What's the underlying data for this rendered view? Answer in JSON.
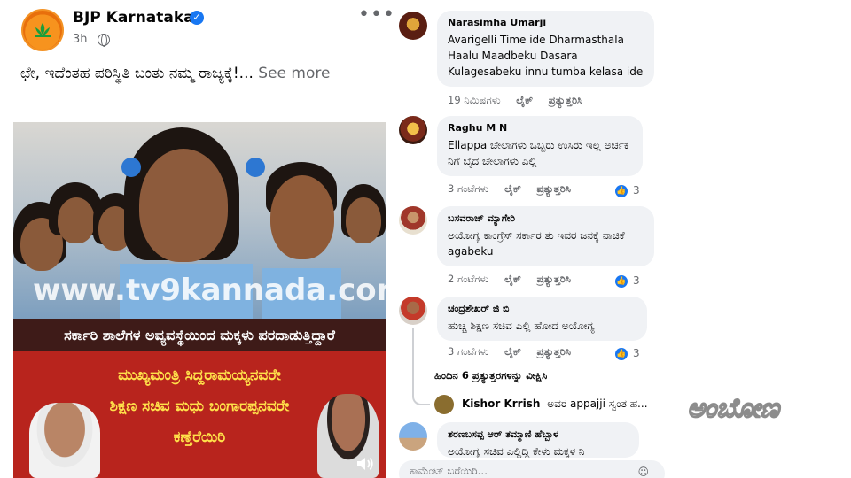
{
  "post": {
    "page_name": "BJP Karnataka",
    "time": "3h",
    "caption": "ಛೇ, ಇದೆಂತಹ ಪರಿಸ್ಥಿತಿ ಬಂತು ನಮ್ಮ ರಾಜ್ಯಕ್ಕೆ!...",
    "see_more": "See more",
    "media": {
      "watermark": "www.tv9kannada.com",
      "banner_line1": "ಸರ್ಕಾರಿ ಶಾಲೆಗಳ ಅವ್ಯವಸ್ಥೆಯಿಂದ ಮಕ್ಕಳು ಪರದಾಡುತ್ತಿದ್ದಾರೆ",
      "banner_line2": "ಮುಖ್ಯಮಂತ್ರಿ ಸಿದ್ದರಾಮಯ್ಯನವರೇ",
      "banner_line3": "ಶಿಕ್ಷಣ ಸಚಿವ ಮಧು ಬಂಗಾರಪ್ಪನವರೇ",
      "banner_line4": "ಕಣ್ತೆರೆಯಿರಿ"
    }
  },
  "comments": [
    {
      "name": "Narasimha Umarji",
      "text": "Avarigelli Time ide Dharmasthala Haalu Maadbeku Dasara Kulagesabeku innu tumba kelasa ide",
      "time": "19 ನಿಮಿಷಗಳು",
      "like": "ಲೈಕ್",
      "reply": "ಪ್ರತ್ಯುತ್ತರಿಸಿ",
      "reactions": ""
    },
    {
      "name": "Raghu M N",
      "text": "Ellappa ಚೇಲಾಗಳು ಒಬ್ಬರು ಉಸಿರು ಇಲ್ಲ ಅರ್ಚಕ ನಿಗೆ ಬೈದ ಚೇಲಾಗಳು ಎಲ್ಲಿ",
      "time": "3 ಗಂಟೆಗಳು",
      "like": "ಲೈಕ್",
      "reply": "ಪ್ರತ್ಯುತ್ತರಿಸಿ",
      "reactions": "3"
    },
    {
      "name": "ಬಸವರಾಜ್ ಮ್ಯಾಗೇರಿ",
      "text": "ಅಯೋಗ್ಯ ಕಾಂಗ್ರೆಸ್ ಸರ್ಕಾರ ತು ಇವರ ಜನಕ್ಕೆ ನಾಚಿಕೆ agabeku",
      "time": "2 ಗಂಟೆಗಳು",
      "like": "ಲೈಕ್",
      "reply": "ಪ್ರತ್ಯುತ್ತರಿಸಿ",
      "reactions": "3"
    },
    {
      "name": "ಚಂದ್ರಶೇಖರ್ ಜಿ ಬಿ",
      "text": "ಹುಚ್ಚ ಶಿಕ್ಷಣ ಸಚಿವ ಎಲ್ಲಿ ಹೋದ ಅಯೋಗ್ಯ",
      "time": "3 ಗಂಟೆಗಳು",
      "like": "ಲೈಕ್",
      "reply": "ಪ್ರತ್ಯುತ್ತರಿಸಿ",
      "reactions": "3"
    }
  ],
  "view_previous_replies": "ಹಿಂದಿನ 6 ಪ್ರತ್ಯುತ್ತರಗಳನ್ನು ವೀಕ್ಷಿಸಿ",
  "reply_preview": {
    "name": "Kishor Krrish",
    "text": "ಅವರ appajji ಸ್ವಂತ ಹ..."
  },
  "last_comment": {
    "name": "ಶರಣಬಸಪ್ಪ ಆರ್ ತಮ್ಮಾಣಿ ಹೆಬ್ಬಾಳ",
    "text": "ಅಯೋಗ್ಯ ಸಚಿವ ಎಲ್ಲಿದ್ದಿ ಕೇಳು ಮಕ್ಕಳ ನಿ"
  },
  "comment_box": {
    "placeholder": "ಕಾಮೆಂಟ್ ಬರೆಯಿರಿ..."
  },
  "brand_logo": "ಅಂಬೋಣ",
  "colors": {
    "accent": "#1877f2",
    "bubble": "#f0f2f5",
    "banner_red": "#b8241d",
    "banner_yellow": "#ffe14a",
    "bjp_orange": "#f7931e"
  }
}
